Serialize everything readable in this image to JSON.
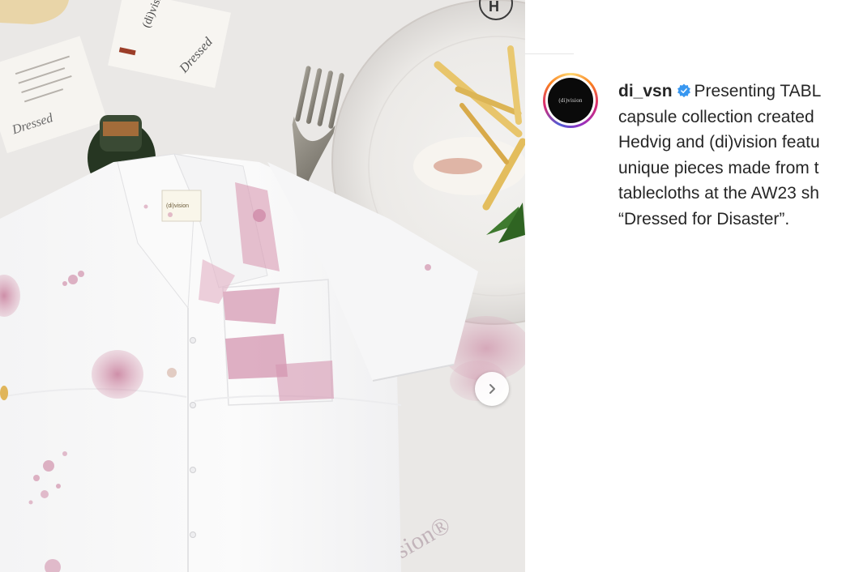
{
  "post": {
    "username": "di_vsn",
    "avatar_text": "(di)vision",
    "caption_lines": [
      "Presenting TABL",
      "capsule collection created",
      "Hedvig and (di)vision featu",
      "unique pieces made from t",
      "tablecloths at the AW23 sh",
      "“Dressed for Disaster”."
    ]
  },
  "photo": {
    "card_brand": "(di)vision",
    "card_script": "Dressed",
    "card_script_2": "Dressed",
    "shirt_label": "(di)vision",
    "tablecloth_text": "sion®"
  },
  "icons": {
    "verified": "verified-badge-icon",
    "next": "chevron-right-icon"
  },
  "colors": {
    "verified_blue": "#3897f0",
    "wine_stain": "#c9849f"
  }
}
